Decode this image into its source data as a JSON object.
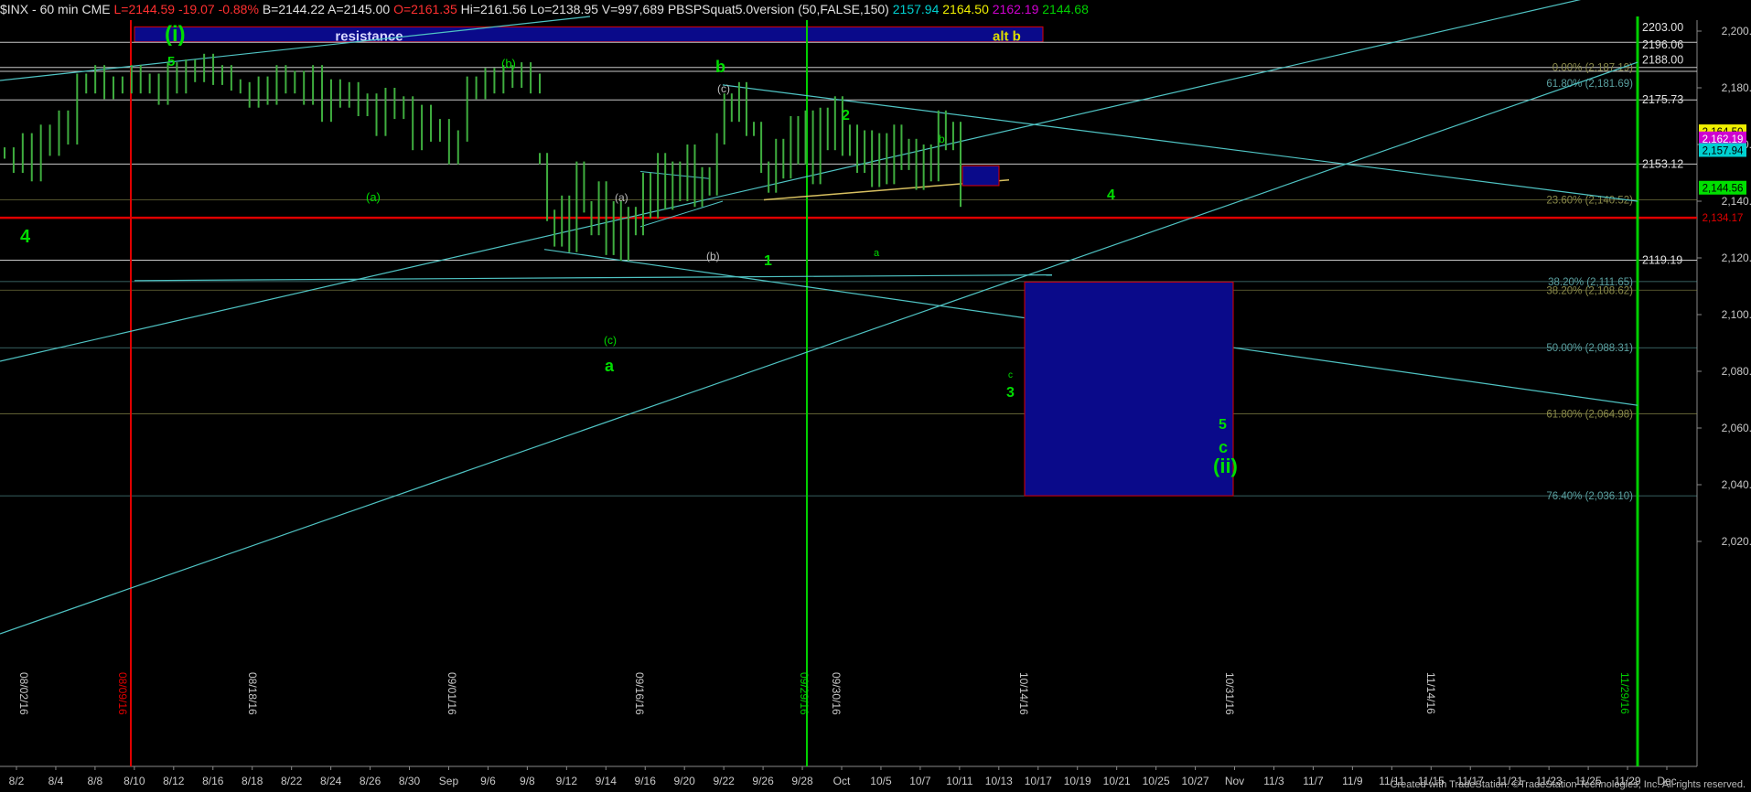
{
  "header": {
    "symbol": "$INX - 60 min",
    "exchange": "CME",
    "last": "L=2144.59",
    "change": "-19.07",
    "change_pct": "-0.88%",
    "bid": "B=2144.22",
    "ask": "A=2145.00",
    "open": "O=2161.35",
    "high": "Hi=2161.56",
    "low": "Lo=2138.95",
    "volume": "V=997,689",
    "study": "PBSPSquat5.0version (50,FALSE,150)",
    "study_v1": "2157.94",
    "study_v2": "2164.50",
    "study_v3": "2162.19",
    "study_v4": "2144.68"
  },
  "colors": {
    "background": "#000000",
    "price_bar": "#3fae3f",
    "channel": "#4fc3c3",
    "horizontal_level": "#c8c8c8",
    "support_line": "#e00000",
    "green_vline": "#00d000",
    "red_vline": "#e00000",
    "box_fill": "#0a0a8a",
    "wave_label": "#00dd00",
    "fib_text": "#8a8a4a",
    "fib_text_cyan": "#5aa0a0"
  },
  "chart_data": {
    "type": "line",
    "title": "",
    "xlabel": "",
    "ylabel": "",
    "ylim": [
      2005,
      2210
    ],
    "y_ticks": [
      "2,200.00",
      "2,180.00",
      "2,160.00",
      "2,140.00",
      "2,120.00",
      "2,100.00",
      "2,080.00",
      "2,060.00",
      "2,040.00",
      "2,020.00"
    ],
    "y_tick_values": [
      2200,
      2180,
      2160,
      2140,
      2120,
      2100,
      2080,
      2060,
      2040,
      2020
    ],
    "x_tick_labels": [
      "8/2",
      "8/4",
      "8/8",
      "8/10",
      "8/12",
      "8/16",
      "8/18",
      "8/22",
      "8/24",
      "8/26",
      "8/30",
      "Sep",
      "9/6",
      "9/8",
      "9/12",
      "9/14",
      "9/16",
      "9/20",
      "9/22",
      "9/26",
      "9/28",
      "Oct",
      "10/5",
      "10/7",
      "10/11",
      "10/13",
      "10/17",
      "10/19",
      "10/21",
      "10/25",
      "10/27",
      "Nov",
      "11/3",
      "11/7",
      "11/9",
      "11/11",
      "11/15",
      "11/17",
      "11/21",
      "11/23",
      "11/25",
      "11/29",
      "Dec"
    ],
    "x_vertical_dates": [
      "08/02/16",
      "08/09/16",
      "08/18/16",
      "09/01/16",
      "09/16/16",
      "09/29/16",
      "09/30/16",
      "10/14/16",
      "10/31/16",
      "11/14/16",
      "11/29/16"
    ],
    "series": [
      {
        "name": "",
        "values": [
          2157,
          2152,
          2162,
          2149,
          2165,
          2158,
          2170,
          2162,
          2183,
          2180,
          2186,
          2178,
          2182,
          2180,
          2186,
          2180,
          2183,
          2176,
          2187,
          2180,
          2188,
          2184,
          2190,
          2183,
          2186,
          2181,
          2180,
          2175,
          2182,
          2176,
          2186,
          2180,
          2184,
          2176,
          2186,
          2170,
          2181,
          2175,
          2180,
          2172,
          2176,
          2165,
          2178,
          2171,
          2175,
          2160,
          2172,
          2163,
          2167,
          2155,
          2163,
          2182,
          2178,
          2185,
          2180,
          2186,
          2182,
          2187,
          2180,
          2183,
          2155,
          2135,
          2126,
          2140,
          2124,
          2152,
          2138,
          2130,
          2145,
          2123,
          2138,
          2121,
          2136,
          2130,
          2148,
          2136,
          2155,
          2139,
          2152,
          2142,
          2158,
          2140,
          2150,
          2144,
          2162,
          2176,
          2170,
          2180,
          2165,
          2166,
          2152,
          2145,
          2160,
          2150,
          2168,
          2155,
          2170,
          2148,
          2171,
          2160,
          2175,
          2158,
          2165,
          2152,
          2163,
          2147,
          2162,
          2148,
          2165,
          2153,
          2160,
          2146,
          2158,
          2149,
          2170,
          2160,
          2166,
          2140
        ]
      }
    ],
    "horizontal_levels": [
      2196.06,
      2187.19,
      2175.73,
      2153.12,
      2119.19
    ],
    "support_level": 2134.17,
    "price_badges": [
      "2203.00",
      "2196.06",
      "2188.00",
      "2175.73",
      "2153.12",
      "2119.19"
    ],
    "right_badges": [
      {
        "text": "2,164.50",
        "bg": "#f0f000",
        "fg": "#000"
      },
      {
        "text": "2,162.19",
        "bg": "#d000d0",
        "fg": "#fff"
      },
      {
        "text": "2,157.94",
        "bg": "#00d0d0",
        "fg": "#000"
      },
      {
        "text": "2,144.56",
        "bg": "#00e000",
        "fg": "#000"
      },
      {
        "text": "2,134.17",
        "bg": "#000",
        "fg": "#e00000"
      }
    ],
    "fib_levels": [
      {
        "text": "0.00% (2,187.19)",
        "value": 2187.19
      },
      {
        "text": "61.80% (2,181.69)",
        "value": 2181.69
      },
      {
        "text": "23.60% (2,140.52)",
        "value": 2140.52
      },
      {
        "text": "38.20% (2,111.65)",
        "value": 2111.65
      },
      {
        "text": "38.20% (2,108.62)",
        "value": 2108.62
      },
      {
        "text": "50.00% (2,088.31)",
        "value": 2088.31
      },
      {
        "text": "61.80% (2,064.98)",
        "value": 2064.98
      },
      {
        "text": "76.40% (2,036.10)",
        "value": 2036.1
      }
    ],
    "resistance_label": "resistance",
    "alt_label": "alt b",
    "wave_labels": [
      "4",
      "(i)",
      "5",
      "(a)",
      "(b)",
      "b",
      "(c)",
      "(a)",
      "(b)",
      "a",
      "(c)",
      "1",
      "2",
      "a",
      "b",
      "4",
      "c",
      "3",
      "5",
      "c",
      "(ii)"
    ]
  },
  "footer": {
    "credit": "Created with TradeStation. ©TradeStation Technologies, Inc. All rights reserved."
  }
}
